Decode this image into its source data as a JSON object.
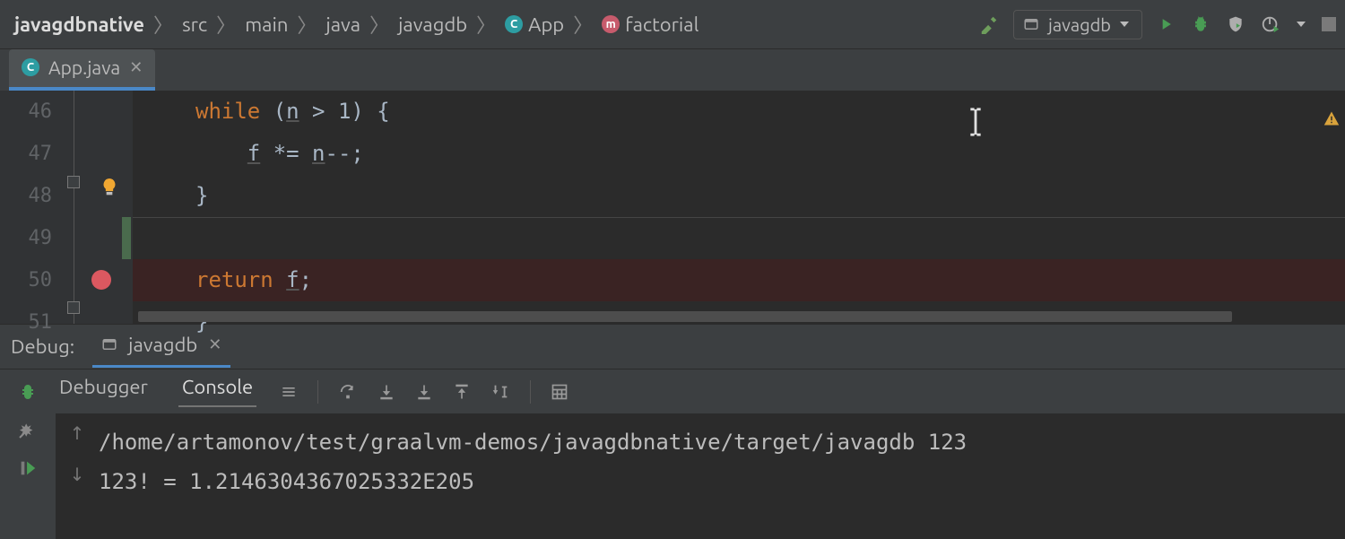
{
  "breadcrumbs": {
    "root": "javagdbnative",
    "p1": "src",
    "p2": "main",
    "p3": "java",
    "p4": "javagdb",
    "cls": "App",
    "method": "factorial"
  },
  "run_config": "javagdb",
  "editor_tab": "App.java",
  "code": {
    "l46": {
      "num": "46",
      "text_kw": "while",
      "text_rest": " (n > 1) {"
    },
    "l47": {
      "num": "47",
      "text": "    f *= n--;"
    },
    "l48": {
      "num": "48",
      "text": "}"
    },
    "l49": {
      "num": "49",
      "text": ""
    },
    "l50": {
      "num": "50",
      "kw": "return",
      "rest": " f;"
    },
    "l51": {
      "num": "51",
      "text": "}"
    }
  },
  "debug": {
    "title": "Debug:",
    "config": "javagdb",
    "tab_debugger": "Debugger",
    "tab_console": "Console"
  },
  "console": {
    "line1": "/home/artamonov/test/graalvm-demos/javagdbnative/target/javagdb 123",
    "line2": "123! = 1.2146304367025332E205"
  }
}
